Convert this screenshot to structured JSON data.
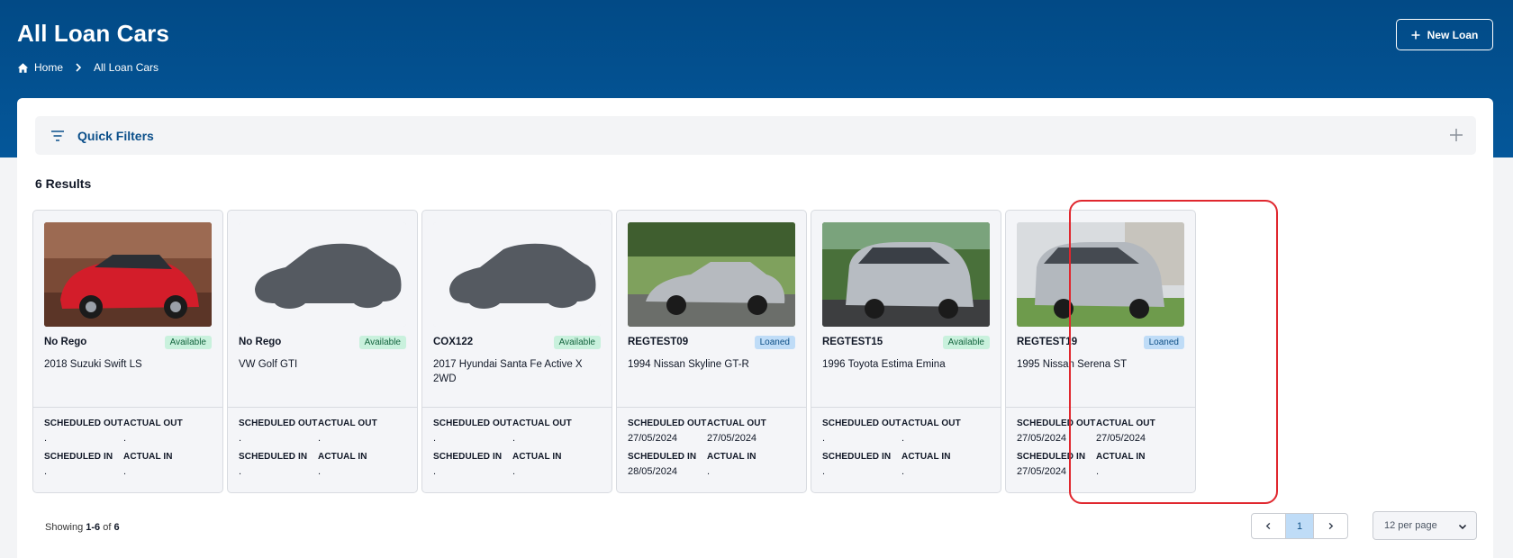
{
  "header": {
    "title": "All Loan Cars",
    "breadcrumb": {
      "home": "Home",
      "current": "All Loan Cars"
    },
    "new_button": "New Loan"
  },
  "filters": {
    "label": "Quick Filters"
  },
  "results_label": "6 Results",
  "labels": {
    "scheduled_out": "SCHEDULED OUT",
    "actual_out": "ACTUAL OUT",
    "scheduled_in": "SCHEDULED IN",
    "actual_in": "ACTUAL IN"
  },
  "cars": [
    {
      "rego": "No Rego",
      "status": "Available",
      "model": "2018 Suzuki Swift LS",
      "scheduled_out": ".",
      "actual_out": ".",
      "scheduled_in": ".",
      "actual_in": "."
    },
    {
      "rego": "No Rego",
      "status": "Available",
      "model": "VW Golf GTI",
      "scheduled_out": ".",
      "actual_out": ".",
      "scheduled_in": ".",
      "actual_in": "."
    },
    {
      "rego": "COX122",
      "status": "Available",
      "model": "2017 Hyundai Santa Fe Active X 2WD",
      "scheduled_out": ".",
      "actual_out": ".",
      "scheduled_in": ".",
      "actual_in": "."
    },
    {
      "rego": "REGTEST09",
      "status": "Loaned",
      "model": "1994 Nissan Skyline GT-R",
      "scheduled_out": "27/05/2024",
      "actual_out": "27/05/2024",
      "scheduled_in": "28/05/2024",
      "actual_in": "."
    },
    {
      "rego": "REGTEST15",
      "status": "Available",
      "model": "1996 Toyota Estima Emina",
      "scheduled_out": ".",
      "actual_out": ".",
      "scheduled_in": ".",
      "actual_in": "."
    },
    {
      "rego": "REGTEST19",
      "status": "Loaned",
      "model": "1995 Nissan Serena ST",
      "scheduled_out": "27/05/2024",
      "actual_out": "27/05/2024",
      "scheduled_in": "27/05/2024",
      "actual_in": "."
    }
  ],
  "pagination": {
    "showing_prefix": "Showing",
    "range": "1-6",
    "of_word": "of",
    "total": "6",
    "current_page": "1",
    "per_page": "12 per page"
  },
  "colors": {
    "header_blue": "#04579a",
    "available_badge": "#c9f1dd",
    "loaned_badge": "#bfdcf7",
    "highlight": "#e0272e"
  }
}
